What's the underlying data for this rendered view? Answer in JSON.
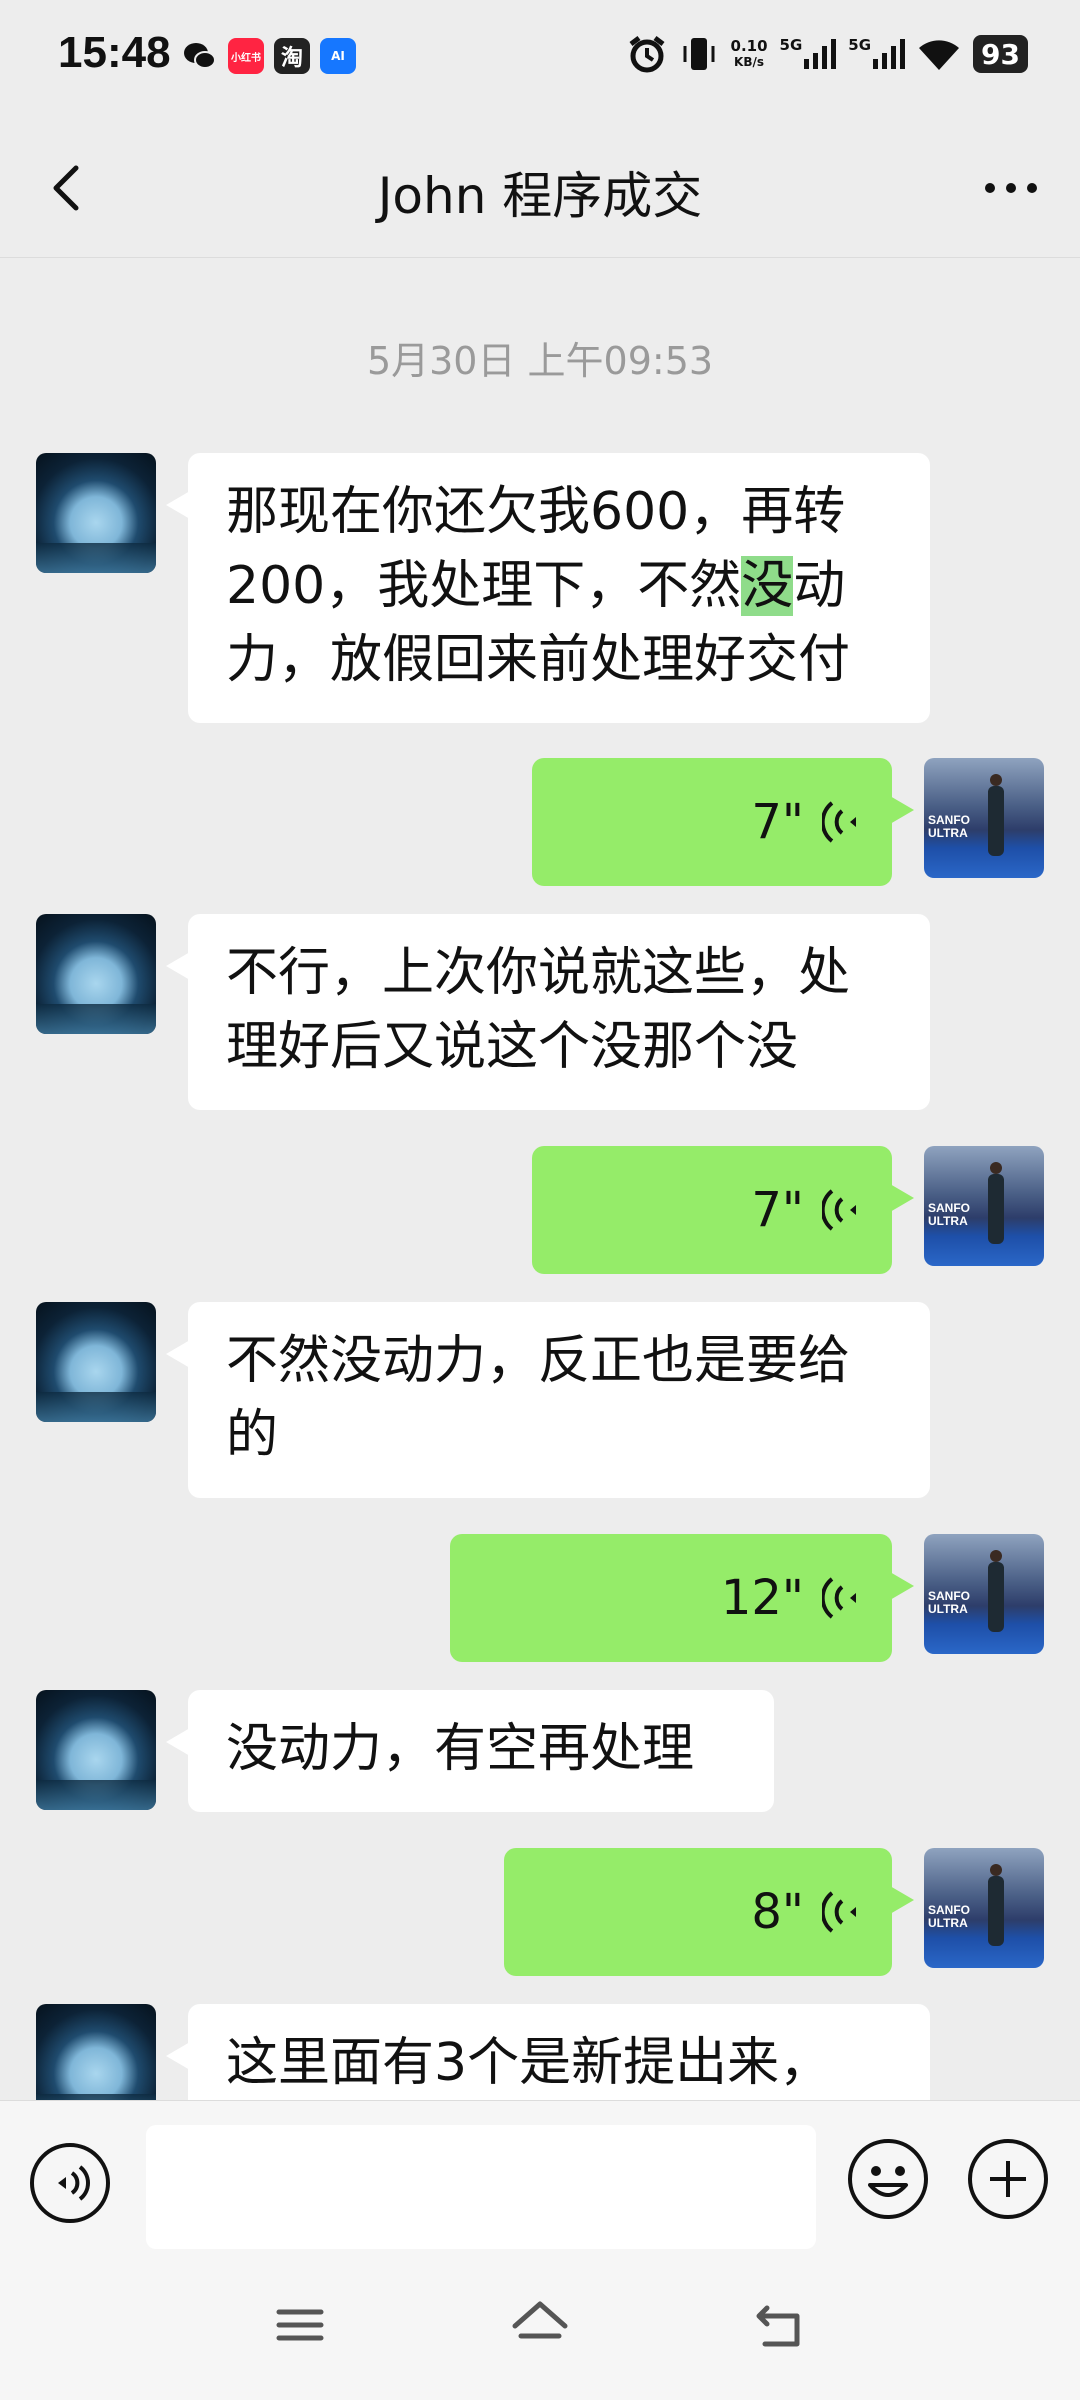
{
  "status_bar": {
    "time": "15:48",
    "apps": [
      {
        "name": "wechat-icon",
        "label": "",
        "color": "#111111"
      },
      {
        "name": "xiaohongshu-icon",
        "label": "小红书",
        "color": "#ff2442"
      },
      {
        "name": "taobao-icon",
        "label": "淘",
        "color": "#222222"
      },
      {
        "name": "ai-app-icon",
        "label": "AI",
        "color": "#1677ff"
      }
    ],
    "net_speed": "0.10",
    "net_unit": "KB/s",
    "sim1": "5G",
    "sim2": "5G",
    "battery": "93"
  },
  "header": {
    "title": "John 程序成交"
  },
  "chat": {
    "timestamp": "5月30日 上午09:53",
    "messages": [
      {
        "side": "left",
        "type": "text",
        "line1": "那现在你还欠我600，再转",
        "line2a": "200，我处理下，不然",
        "line2hl": "没",
        "line2b": "动",
        "line3": "力，放假回来前处理好交付"
      },
      {
        "side": "right",
        "type": "voice",
        "duration": "7\""
      },
      {
        "side": "left",
        "type": "text",
        "line1": "不行，上次你说就这些，处",
        "line2": "理好后又说这个没那个没"
      },
      {
        "side": "right",
        "type": "voice",
        "duration": "7\""
      },
      {
        "side": "left",
        "type": "text",
        "line1": "不然没动力，反正也是要给",
        "line2": "的"
      },
      {
        "side": "right",
        "type": "voice",
        "duration": "12\""
      },
      {
        "side": "left",
        "type": "text",
        "line1": "没动力，有空再处理"
      },
      {
        "side": "right",
        "type": "voice",
        "duration": "8\""
      },
      {
        "side": "left",
        "type": "text",
        "line1": "这里面有3个是新提出来，"
      }
    ]
  },
  "avatar_banner": "SANFO ULTRA",
  "colors": {
    "background": "#ededed",
    "sent_bubble": "#95ec69",
    "received_bubble": "#ffffff",
    "highlight": "#8fdc8a"
  }
}
